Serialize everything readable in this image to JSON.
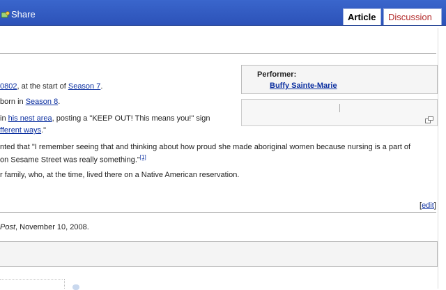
{
  "topbar": {
    "share_label": "Share",
    "tabs": {
      "article": "Article",
      "discussion": "Discussion"
    }
  },
  "content": {
    "l1": {
      "link1": "0802",
      "text": ", at the start of ",
      "link2": "Season 7",
      "end": "."
    },
    "l2": {
      "text": " born in ",
      "link": "Season 8",
      "end": "."
    },
    "l3": {
      "pre": "in ",
      "link": "his nest area",
      "text": ", posting a \"KEEP OUT! This means you!\" sign"
    },
    "l4": {
      "link": "fferent ways",
      "end": ".\""
    },
    "l5": {
      "text": "nted that \"I remember seeing that and thinking about how proud she made aboriginal women because nursing is a part of"
    },
    "l6": {
      "text": "on Sesame Street was really something.\"",
      "ref": "[1]"
    },
    "l7": {
      "text": "r family, who, at the time, lived there on a Native American reservation."
    },
    "edit_label": "edit",
    "date_source": "Post",
    "date_text": ", November 10, 2008."
  },
  "infobox": {
    "label": "Performer:",
    "value": "Buffy Sainte-Marie"
  },
  "colors": {
    "topbar": "#2c52b8",
    "link": "#0b2fa0",
    "discussion_tab": "#b22a2a"
  }
}
